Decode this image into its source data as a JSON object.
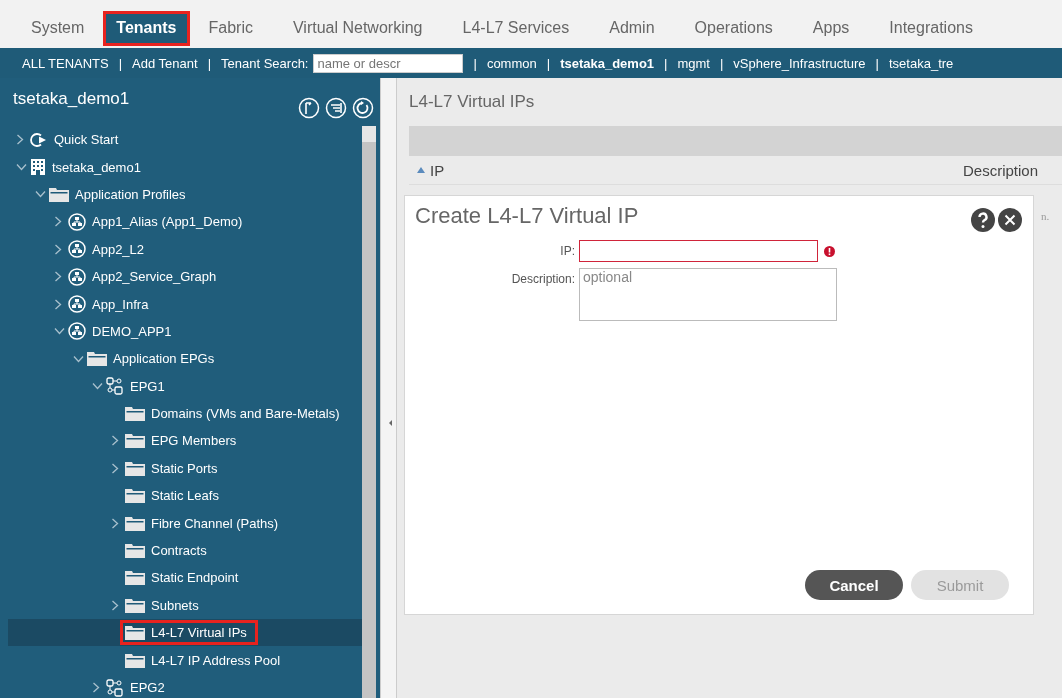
{
  "tabs": [
    {
      "label": "System",
      "selected": false,
      "highlighted": false
    },
    {
      "label": "Tenants",
      "selected": true,
      "highlighted": true
    },
    {
      "label": "Fabric",
      "selected": false,
      "highlighted": false
    },
    {
      "label": "Virtual Networking",
      "selected": false,
      "highlighted": false
    },
    {
      "label": "L4-L7 Services",
      "selected": false,
      "highlighted": false
    },
    {
      "label": "Admin",
      "selected": false,
      "highlighted": false
    },
    {
      "label": "Operations",
      "selected": false,
      "highlighted": false
    },
    {
      "label": "Apps",
      "selected": false,
      "highlighted": false
    },
    {
      "label": "Integrations",
      "selected": false,
      "highlighted": false
    }
  ],
  "subnav": [
    {
      "kind": "link",
      "text": "ALL TENANTS",
      "selected": false
    },
    {
      "kind": "separator",
      "text": "|"
    },
    {
      "kind": "link",
      "text": "Add Tenant",
      "selected": false
    },
    {
      "kind": "separator",
      "text": "|"
    },
    {
      "kind": "search",
      "text": "Tenant Search:",
      "placeholder": "name or descr"
    },
    {
      "kind": "separator",
      "text": "|"
    },
    {
      "kind": "link",
      "text": "common",
      "selected": false
    },
    {
      "kind": "separator",
      "text": "|"
    },
    {
      "kind": "link",
      "text": "tsetaka_demo1",
      "selected": true
    },
    {
      "kind": "separator",
      "text": "|"
    },
    {
      "kind": "link",
      "text": "mgmt",
      "selected": false
    },
    {
      "kind": "separator",
      "text": "|"
    },
    {
      "kind": "link",
      "text": "vSphere_Infrastructure",
      "selected": false
    },
    {
      "kind": "separator",
      "text": "|"
    },
    {
      "kind": "link",
      "text": "tsetaka_tre",
      "selected": false
    }
  ],
  "sidebar": {
    "title": "tsetaka_demo1",
    "tree": [
      {
        "label": "Quick Start",
        "kind": "quick-start",
        "expanded": false,
        "selected": false,
        "highlighted": false
      },
      {
        "label": "tsetaka_demo1",
        "kind": "tenant",
        "expanded": true,
        "selected": false,
        "highlighted": false,
        "children": [
          {
            "label": "Application Profiles",
            "kind": "folder",
            "expanded": true,
            "selected": false,
            "highlighted": false,
            "children": [
              {
                "label": "App1_Alias (App1_Demo)",
                "kind": "app",
                "expanded": false,
                "selected": false,
                "highlighted": false
              },
              {
                "label": "App2_L2",
                "kind": "app",
                "expanded": false,
                "selected": false,
                "highlighted": false
              },
              {
                "label": "App2_Service_Graph",
                "kind": "app",
                "expanded": false,
                "selected": false,
                "highlighted": false
              },
              {
                "label": "App_Infra",
                "kind": "app",
                "expanded": false,
                "selected": false,
                "highlighted": false
              },
              {
                "label": "DEMO_APP1",
                "kind": "app",
                "expanded": true,
                "selected": false,
                "highlighted": false,
                "children": [
                  {
                    "label": "Application EPGs",
                    "kind": "folder",
                    "expanded": true,
                    "selected": false,
                    "highlighted": false,
                    "children": [
                      {
                        "label": "EPG1",
                        "kind": "epg",
                        "expanded": true,
                        "selected": false,
                        "highlighted": false,
                        "children": [
                          {
                            "label": "Domains (VMs and Bare-Metals)",
                            "kind": "folder",
                            "selected": false,
                            "highlighted": false
                          },
                          {
                            "label": "EPG Members",
                            "kind": "folder",
                            "expanded": false,
                            "selected": false,
                            "highlighted": false
                          },
                          {
                            "label": "Static Ports",
                            "kind": "folder",
                            "expanded": false,
                            "selected": false,
                            "highlighted": false
                          },
                          {
                            "label": "Static Leafs",
                            "kind": "folder",
                            "selected": false,
                            "highlighted": false
                          },
                          {
                            "label": "Fibre Channel (Paths)",
                            "kind": "folder",
                            "expanded": false,
                            "selected": false,
                            "highlighted": false
                          },
                          {
                            "label": "Contracts",
                            "kind": "folder",
                            "selected": false,
                            "highlighted": false
                          },
                          {
                            "label": "Static Endpoint",
                            "kind": "folder",
                            "selected": false,
                            "highlighted": false
                          },
                          {
                            "label": "Subnets",
                            "kind": "folder",
                            "expanded": false,
                            "selected": false,
                            "highlighted": false
                          },
                          {
                            "label": "L4-L7 Virtual IPs",
                            "kind": "folder",
                            "selected": true,
                            "highlighted": true
                          },
                          {
                            "label": "L4-L7 IP Address Pool",
                            "kind": "folder",
                            "selected": false,
                            "highlighted": false
                          }
                        ]
                      },
                      {
                        "label": "EPG2",
                        "kind": "epg",
                        "expanded": false,
                        "selected": false,
                        "highlighted": false
                      }
                    ]
                  }
                ]
              }
            ]
          }
        ]
      }
    ]
  },
  "content": {
    "title": "L4-L7 Virtual IPs",
    "columns": [
      {
        "label": "IP",
        "sorted": true
      },
      {
        "label": "Description",
        "sorted": false
      }
    ],
    "hidden_text": "n."
  },
  "dialog": {
    "title": "Create L4-L7 Virtual IP",
    "fields": [
      {
        "label": "IP:",
        "kind": "input",
        "invalid": true
      },
      {
        "label": "Description:",
        "kind": "textarea",
        "placeholder": "optional",
        "invalid": false
      }
    ],
    "buttons": [
      {
        "label": "Cancel",
        "disabled": false
      },
      {
        "label": "Submit",
        "disabled": true
      }
    ]
  }
}
